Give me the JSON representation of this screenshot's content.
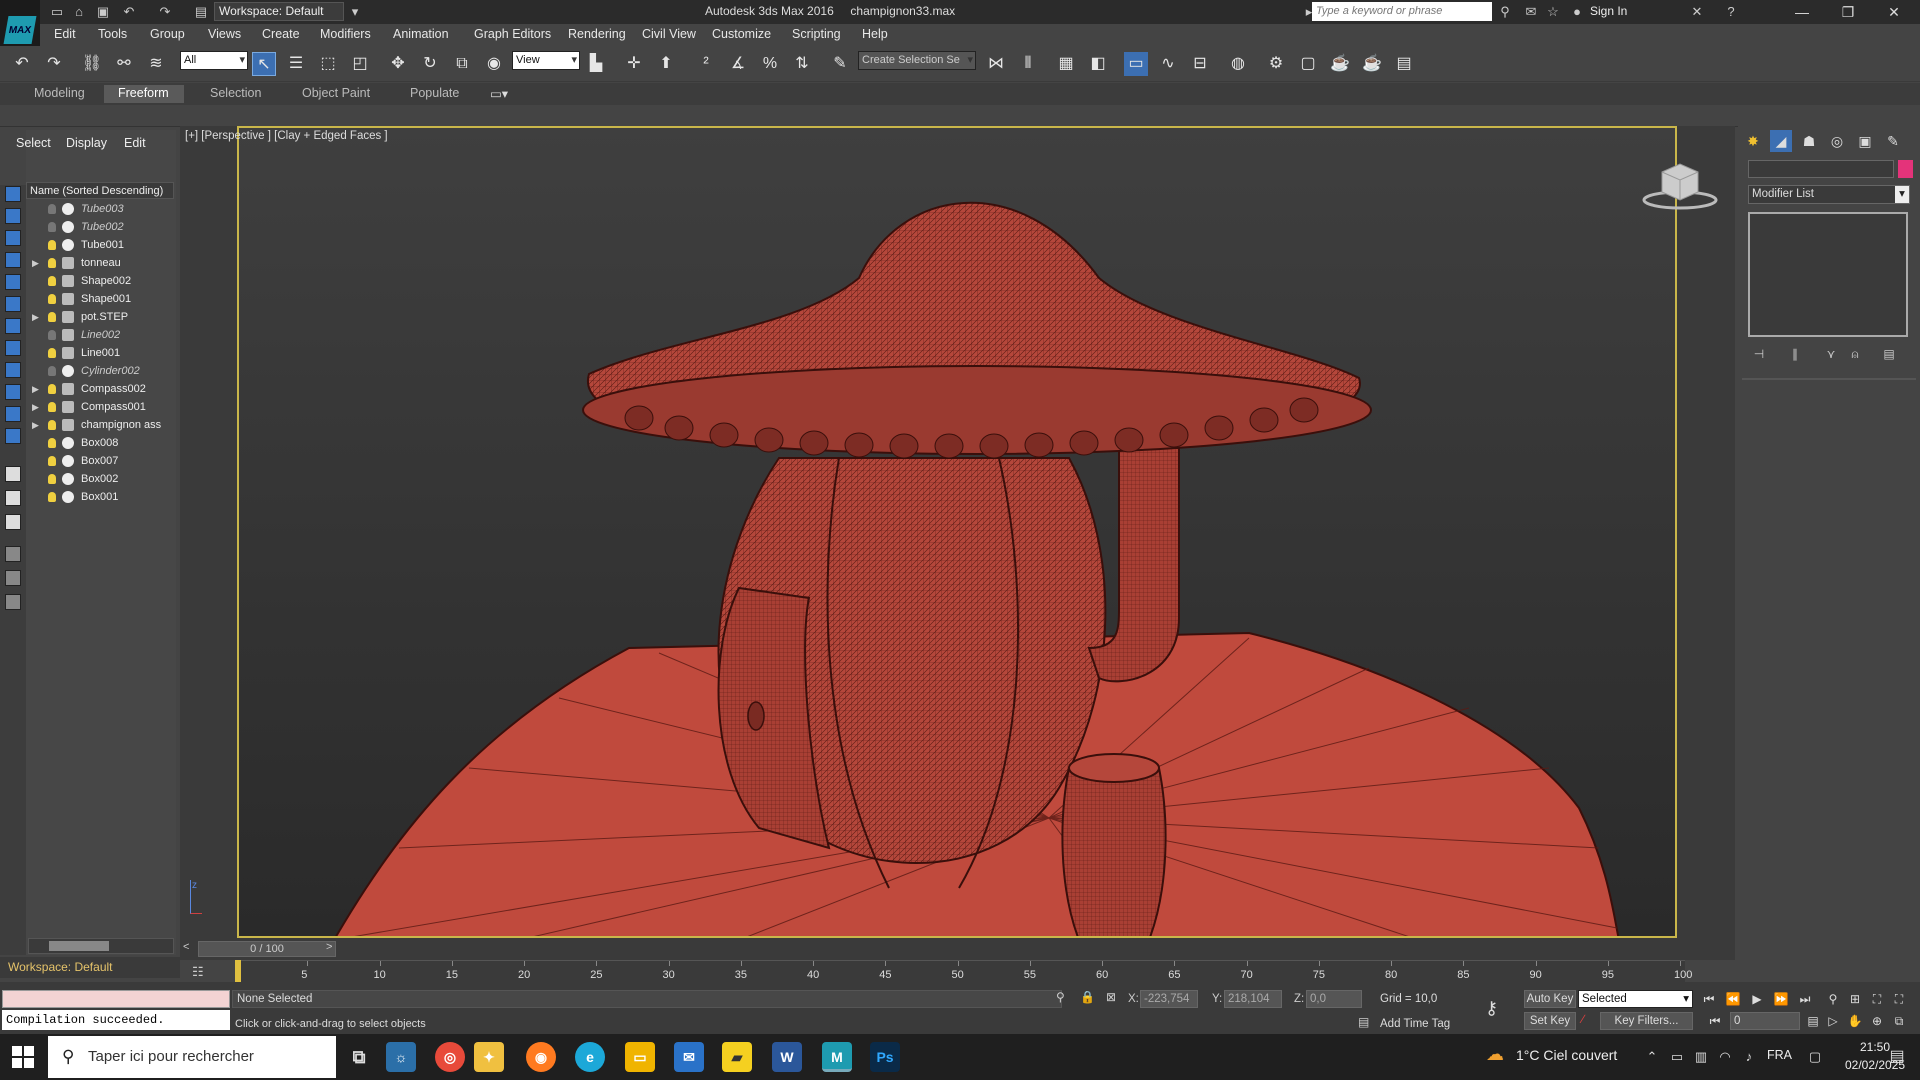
{
  "window": {
    "app_title": "Autodesk 3ds Max 2016     champignon33.max",
    "workspace": "Workspace: Default",
    "search_placeholder": "Type a keyword or phrase",
    "sign_in": "Sign In",
    "logo_text": "MAX"
  },
  "menu": [
    "Edit",
    "Tools",
    "Group",
    "Views",
    "Create",
    "Modifiers",
    "Animation",
    "Graph Editors",
    "Rendering",
    "Civil View",
    "Customize",
    "Scripting",
    "Help"
  ],
  "toolbar": {
    "filter_value": "All",
    "coord_value": "View",
    "selection_set_value": "Create Selection Se"
  },
  "ribbon_tabs": [
    "Modeling",
    "Freeform",
    "Selection",
    "Object Paint",
    "Populate"
  ],
  "scene_explorer": {
    "tabs": [
      "Select",
      "Display",
      "Edit"
    ],
    "header": "Name (Sorted Descending)",
    "rows": [
      {
        "name": "Tube003",
        "hidden": true,
        "expandable": false,
        "kind": "sphere"
      },
      {
        "name": "Tube002",
        "hidden": true,
        "expandable": false,
        "kind": "sphere"
      },
      {
        "name": "Tube001",
        "hidden": false,
        "expandable": false,
        "kind": "sphere"
      },
      {
        "name": "tonneau",
        "hidden": false,
        "expandable": true,
        "kind": "shape"
      },
      {
        "name": "Shape002",
        "hidden": false,
        "expandable": false,
        "kind": "shape"
      },
      {
        "name": "Shape001",
        "hidden": false,
        "expandable": false,
        "kind": "shape"
      },
      {
        "name": "pot.STEP",
        "hidden": false,
        "expandable": true,
        "kind": "shape"
      },
      {
        "name": "Line002",
        "hidden": true,
        "expandable": false,
        "kind": "shape"
      },
      {
        "name": "Line001",
        "hidden": false,
        "expandable": false,
        "kind": "shape"
      },
      {
        "name": "Cylinder002",
        "hidden": true,
        "expandable": false,
        "kind": "sphere"
      },
      {
        "name": "Compass002",
        "hidden": false,
        "expandable": true,
        "kind": "shape"
      },
      {
        "name": "Compass001",
        "hidden": false,
        "expandable": true,
        "kind": "shape"
      },
      {
        "name": "champignon ass",
        "hidden": false,
        "expandable": true,
        "kind": "shape"
      },
      {
        "name": "Box008",
        "hidden": false,
        "expandable": false,
        "kind": "sphere"
      },
      {
        "name": "Box007",
        "hidden": false,
        "expandable": false,
        "kind": "sphere"
      },
      {
        "name": "Box002",
        "hidden": false,
        "expandable": false,
        "kind": "sphere"
      },
      {
        "name": "Box001",
        "hidden": false,
        "expandable": false,
        "kind": "sphere"
      }
    ],
    "workspace_label": "Workspace: Default"
  },
  "viewport": {
    "label": "[+] [Perspective ] [Clay + Edged Faces ]",
    "axis_z": "z",
    "mesh_color": "#b5473b",
    "wire_color": "#5a1a14"
  },
  "command_panel": {
    "modifier_list": "Modifier List",
    "object_color": "#e4337a"
  },
  "timeline": {
    "slider": "0 / 100",
    "ticks": [
      "5",
      "10",
      "15",
      "20",
      "25",
      "30",
      "35",
      "40",
      "45",
      "50",
      "55",
      "60",
      "65",
      "70",
      "75",
      "80",
      "85",
      "90",
      "95",
      "100"
    ]
  },
  "status": {
    "maxscript_output": "Compilation succeeded.",
    "selection": "None Selected",
    "prompt": "Click or click-and-drag to select objects",
    "x_label": "X:",
    "x_value": "-223,754",
    "y_label": "Y:",
    "y_value": "218,104",
    "z_label": "Z:",
    "z_value": "0,0",
    "grid": "Grid = 10,0",
    "add_time_tag": "Add Time Tag",
    "auto_key": "Auto Key",
    "set_key": "Set Key",
    "key_mode": "Selected",
    "key_filters": "Key Filters...",
    "frame": "0"
  },
  "taskbar": {
    "search_placeholder": "Taper ici pour rechercher",
    "weather": "1°C  Ciel couvert",
    "lang": "FRA",
    "time": "21:50",
    "date": "02/02/2025"
  }
}
